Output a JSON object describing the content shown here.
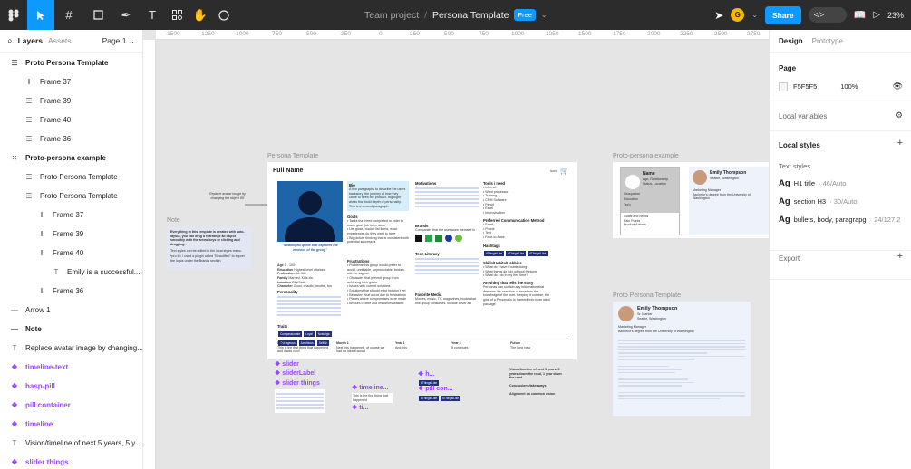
{
  "toolbar": {
    "project": "Team project",
    "separator": "/",
    "file_name": "Persona Template",
    "plan_badge": "Free",
    "user_initial": "G",
    "share_label": "Share",
    "zoom": "23%"
  },
  "left_panel": {
    "tab_layers": "Layers",
    "tab_assets": "Assets",
    "page": "Page 1",
    "layers": [
      {
        "label": "Proto Persona Template",
        "icon": "frame-icon"
      },
      {
        "label": "Frame 37",
        "icon": "autolayout-v-icon"
      },
      {
        "label": "Frame 39",
        "icon": "autolayout-h-icon"
      },
      {
        "label": "Frame 40",
        "icon": "autolayout-h-icon"
      },
      {
        "label": "Frame 36",
        "icon": "autolayout-h-icon"
      },
      {
        "label": "Proto-persona example",
        "icon": "grid-icon"
      },
      {
        "label": "Proto Persona Template",
        "icon": "autolayout-h-icon"
      },
      {
        "label": "Proto Persona Template",
        "icon": "autolayout-h-icon"
      },
      {
        "label": "Frame 37",
        "icon": "autolayout-v-icon"
      },
      {
        "label": "Frame 39",
        "icon": "autolayout-v-icon"
      },
      {
        "label": "Frame 40",
        "icon": "autolayout-v-icon"
      },
      {
        "label": "Emily is a successful...",
        "icon": "text-icon"
      },
      {
        "label": "Frame 36",
        "icon": "autolayout-v-icon"
      },
      {
        "label": "Arrow 1",
        "icon": "line-icon"
      },
      {
        "label": "Note",
        "icon": "line-icon"
      },
      {
        "label": "Replace avatar image by changing...",
        "icon": "text-icon"
      },
      {
        "label": "timeline-text",
        "icon": "component-icon"
      },
      {
        "label": "hasp-pill",
        "icon": "component-icon"
      },
      {
        "label": "pill container",
        "icon": "component-icon"
      },
      {
        "label": "timeline",
        "icon": "component-icon"
      },
      {
        "label": "Vision/timeline of next 5 years, 5 y...",
        "icon": "text-icon"
      },
      {
        "label": "slider things",
        "icon": "component-icon"
      }
    ]
  },
  "ruler": [
    "-1500",
    "-1250",
    "-1000",
    "-750",
    "-500",
    "-250",
    "0",
    "250",
    "500",
    "750",
    "1000",
    "1250",
    "1500",
    "1750",
    "2000",
    "2250",
    "2500",
    "2750"
  ],
  "canvas": {
    "label_persona_template": "Persona Template",
    "label_proto_example": "Proto-persona example",
    "label_proto_template": "Proto Persona Template",
    "label_note": "Note",
    "annotation": "Replace avatar image by changing the object 'fill'",
    "note_text": "Everything in this template is created with auto-layout, you can drag a rearrange all object smoothly with the arrow keys or clicking and dragging.",
    "note_text2": "Text styles can be edited in the local styles menu.",
    "note_text3": "*pro tip: I used a plugin called \"Beautified\" to import the logos under the Brands section",
    "persona": {
      "full_name": "Full Name",
      "icon_label": "icon",
      "quote": "\"Meaningful quote that captures the essence of the group\"",
      "bio_title": "Bio",
      "bio_text": "A few paragraphs to describe the users backstory, the journey of how they came to need the product. Highlight areas that build depth of personality.",
      "bio_second": "This is a second paragraph.",
      "goals_title": "Goals",
      "goals": [
        "Tasks that need completed in order to reach goal, 'job to be done'",
        "Life goals, bucket list items, what experiences do they want to have",
        "Big picture thinking that is consistent with potential successes"
      ],
      "frustrations_title": "Frustrations",
      "frustrations": [
        "Problems this group would prefer to avoid, unreliable, unpredictable, broken with no support",
        "Obstacles that prevent group from achieving their goals",
        "Issues with current solutions",
        "Solutions that should exist but don't yet",
        "Behaviors that occur due to frustrations",
        "Places where compromises were made",
        "Amount of time and resources wasted"
      ],
      "demographics": [
        [
          "Age",
          "1 - 100+"
        ],
        [
          "Education",
          "Highest level attained"
        ],
        [
          "Profession",
          "Job title"
        ],
        [
          "Family",
          "Married, Kids etc"
        ],
        [
          "Location",
          "City/State"
        ],
        [
          "Character",
          "Good, chaotic, neutral, fun"
        ]
      ],
      "personality_title": "Personality",
      "motivations_title": "Motivations",
      "brands_title": "Brands",
      "brands_text": "Companies that the user uses themself in",
      "tech_title": "Tech Literacy",
      "tools_title": "Tools i need",
      "tools": [
        "Internet",
        "Word processor",
        "Training",
        "CRM Software",
        "Pencil",
        "Excel",
        "Improvisation"
      ],
      "comm_title": "Preferred Communication Method",
      "comm": [
        "Email",
        "Phone",
        "Text",
        "Face-to-Face"
      ],
      "hashtags_title": "Hashtags",
      "skills_title": "Skills/Habits/Hobbies",
      "skills": [
        "What do I have trouble doing",
        "What things do I do without thinking",
        "What do I do in my free time?"
      ],
      "story_title": "Anything that tells the story",
      "story_text": "Personas can contain any information that deepens the narrative or broadens the knowledge of the user. Keeping it concise, the goal of a Persona is to transmit info in an ideal package.",
      "media_title": "Favorite Media",
      "media_text": "Movies, music, TV, magazines, books that this group consumes. Include cover art",
      "traits_title": "Traits",
      "traits": [
        "Compassionate",
        "Loyal",
        "Nostalgic",
        "Outrageous",
        "Ambitious",
        "Selfish"
      ],
      "timeline": [
        "Day 1",
        "Month 1",
        "Year 1",
        "Year 2",
        "Future"
      ],
      "timeline_text": [
        "This is the first thing that happened and it was cool!",
        "Next this happened, of course we had no idea it would",
        "And this",
        "It continues",
        "The long view"
      ]
    },
    "components": {
      "slider": "slider",
      "slider_label": "sliderLabel",
      "slider_things": "slider things",
      "timeline": "timeline...",
      "timeline_text": "This is the first thing that happened",
      "ti": "ti...",
      "h": "h...",
      "pill_con": "pill con...",
      "pill": "#ThingsILike",
      "vision": "Vision/timeline of next 5 years, 5 years down the road, 1 year down the road",
      "conclusions": "Conclusions/takeaways",
      "alignment": "Alignment on common vision"
    },
    "example": {
      "name": "Emily Thompson",
      "pronoun": "Sr. Marker",
      "location": "Seattle, Washington",
      "role": "Marketing Manager",
      "degree": "Bachelor's degree from the University of Washington",
      "name_box": "Name",
      "name_sub": "Age, Relationship Status, Location",
      "rows": [
        "Occupation",
        "Education",
        "Tech",
        "Goals and needs",
        "Pain Points",
        "Product Actions"
      ]
    }
  },
  "right_panel": {
    "tab_design": "Design",
    "tab_prototype": "Prototype",
    "page_title": "Page",
    "page_color": "F5F5F5",
    "page_opacity": "100%",
    "local_variables": "Local variables",
    "local_styles": "Local styles",
    "text_styles": "Text styles",
    "ag": "Ag",
    "styles": [
      {
        "name": "H1 title",
        "meta": "46/Auto"
      },
      {
        "name": "section H3",
        "meta": "30/Auto"
      },
      {
        "name": "bullets, body, paragrapg",
        "meta": "24/127.2"
      }
    ],
    "export": "Export"
  },
  "colors": {
    "accent": "#0d99ff",
    "component": "#9747ff",
    "toolbar": "#2c2c2c",
    "navy": "#1f2f7a"
  }
}
